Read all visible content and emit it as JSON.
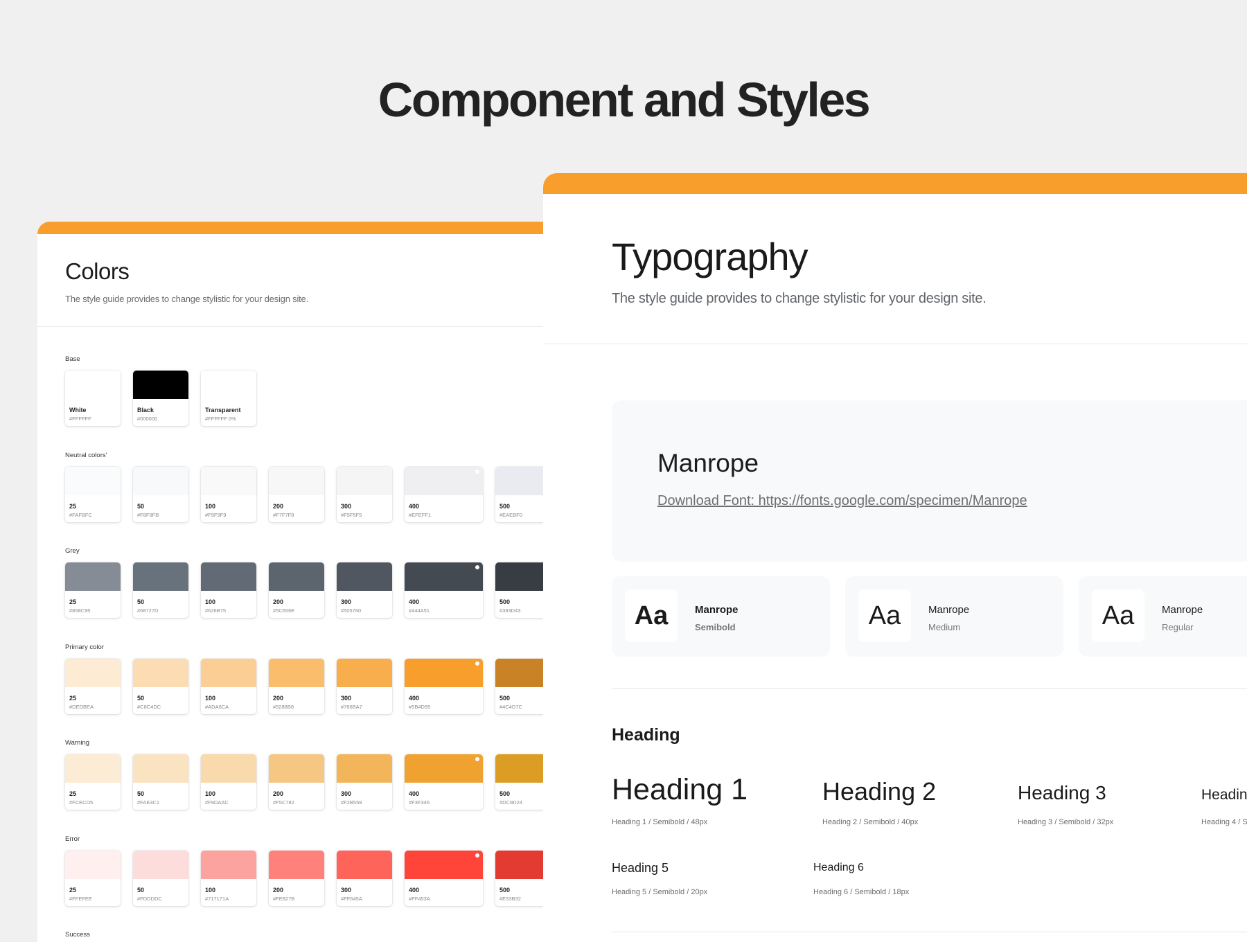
{
  "page": {
    "title": "Component and Styles"
  },
  "colors": {
    "title": "Colors",
    "subtitle": "The style guide provides to change stylistic for your design site.",
    "palettes": [
      {
        "label": "Base",
        "swatches": [
          {
            "name": "White",
            "hex": "#FFFFFF",
            "color": "#FFFFFF"
          },
          {
            "name": "Black",
            "hex": "#000000",
            "color": "#000000"
          },
          {
            "name": "Transparent",
            "hex": "#FFFFFF 0%",
            "color": "#FFFFFF"
          }
        ]
      },
      {
        "label": "Neutral colors'",
        "swatches": [
          {
            "name": "25",
            "hex": "#FAFBFC",
            "color": "#FAFBFC"
          },
          {
            "name": "50",
            "hex": "#F8F9FB",
            "color": "#F8F9FB"
          },
          {
            "name": "100",
            "hex": "#F9F9F9",
            "color": "#F9F9F9"
          },
          {
            "name": "200",
            "hex": "#F7F7F8",
            "color": "#F7F7F8"
          },
          {
            "name": "300",
            "hex": "#F5F5F5",
            "color": "#F5F5F5"
          },
          {
            "name": "400",
            "hex": "#EFEFF1",
            "color": "#EFEFF1",
            "dot": true
          },
          {
            "name": "500",
            "hex": "#EAEBF0",
            "color": "#EAEBF0"
          }
        ]
      },
      {
        "label": "Grey",
        "swatches": [
          {
            "name": "25",
            "hex": "#858C95",
            "color": "#858C95"
          },
          {
            "name": "50",
            "hex": "#68727D",
            "color": "#68727D"
          },
          {
            "name": "100",
            "hex": "#626B75",
            "color": "#626B75"
          },
          {
            "name": "200",
            "hex": "#5C656E",
            "color": "#5C656E"
          },
          {
            "name": "300",
            "hex": "#505760",
            "color": "#505760"
          },
          {
            "name": "400",
            "hex": "#444A51",
            "color": "#444A51",
            "dot": true
          },
          {
            "name": "500",
            "hex": "#383D43",
            "color": "#383D43"
          }
        ]
      },
      {
        "label": "Primary color",
        "swatches": [
          {
            "name": "25",
            "hex": "#DEDBEA",
            "color": "#FDEBD4"
          },
          {
            "name": "50",
            "hex": "#C8C4DC",
            "color": "#FCDDB3"
          },
          {
            "name": "100",
            "hex": "#ADA6CA",
            "color": "#FACE94"
          },
          {
            "name": "200",
            "hex": "#9288B8",
            "color": "#F9BD6C"
          },
          {
            "name": "300",
            "hex": "#766BA7",
            "color": "#F8AE4C"
          },
          {
            "name": "400",
            "hex": "#5B4D95",
            "color": "#F79E2C",
            "dot": true
          },
          {
            "name": "500",
            "hex": "#4C4D7C",
            "color": "#C98226"
          }
        ]
      },
      {
        "label": "Warning",
        "swatches": [
          {
            "name": "25",
            "hex": "#FCECD5",
            "color": "#FCECD5"
          },
          {
            "name": "50",
            "hex": "#FAE3C1",
            "color": "#FAE3C1"
          },
          {
            "name": "100",
            "hex": "#F9DAAC",
            "color": "#F9DAAC"
          },
          {
            "name": "200",
            "hex": "#F5C782",
            "color": "#F5C782"
          },
          {
            "name": "300",
            "hex": "#F2B559",
            "color": "#F2B559"
          },
          {
            "name": "400",
            "hex": "#F3F346",
            "color": "#EFA22F",
            "dot": true
          },
          {
            "name": "500",
            "hex": "#DC9D24",
            "color": "#DC9D24"
          }
        ]
      },
      {
        "label": "Error",
        "swatches": [
          {
            "name": "25",
            "hex": "#FFEFEE",
            "color": "#FFEFEE"
          },
          {
            "name": "50",
            "hex": "#FDDDDC",
            "color": "#FDDDDC"
          },
          {
            "name": "100",
            "hex": "#717171A",
            "color": "#FCA3A0"
          },
          {
            "name": "200",
            "hex": "#FE827B",
            "color": "#FE827B"
          },
          {
            "name": "300",
            "hex": "#FF645A",
            "color": "#FF645A"
          },
          {
            "name": "400",
            "hex": "#FF453A",
            "color": "#FF453A",
            "dot": true
          },
          {
            "name": "500",
            "hex": "#E33B32",
            "color": "#E33B32"
          }
        ]
      }
    ],
    "next_label": "Success"
  },
  "typography": {
    "title": "Typography",
    "subtitle": "The style guide provides to change stylistic for your design site.",
    "font": {
      "name": "Manrope",
      "link": "Download Font: https://fonts.google.com/specimen/Manrope"
    },
    "weights": [
      {
        "sample": "Aa",
        "name": "Manrope",
        "weight": "Semibold"
      },
      {
        "sample": "Aa",
        "name": "Manrope",
        "weight": "Medium"
      },
      {
        "sample": "Aa",
        "name": "Manrope",
        "weight": "Regular"
      }
    ],
    "heading_label": "Heading",
    "headings": [
      {
        "text": "Heading 1",
        "spec": "Heading 1 / Semibold / 48px"
      },
      {
        "text": "Heading 2",
        "spec": "Heading 2 / Semibold / 40px"
      },
      {
        "text": "Heading 3",
        "spec": "Heading 3 / Semibold / 32px"
      },
      {
        "text": "Headin",
        "spec": "Heading 4 / S"
      },
      {
        "text": "Heading 5",
        "spec": "Heading 5 / Semibold / 20px"
      },
      {
        "text": "Heading 6",
        "spec": "Heading 6 / Semibold / 18px"
      }
    ]
  },
  "accent_color": "#F79E2C"
}
